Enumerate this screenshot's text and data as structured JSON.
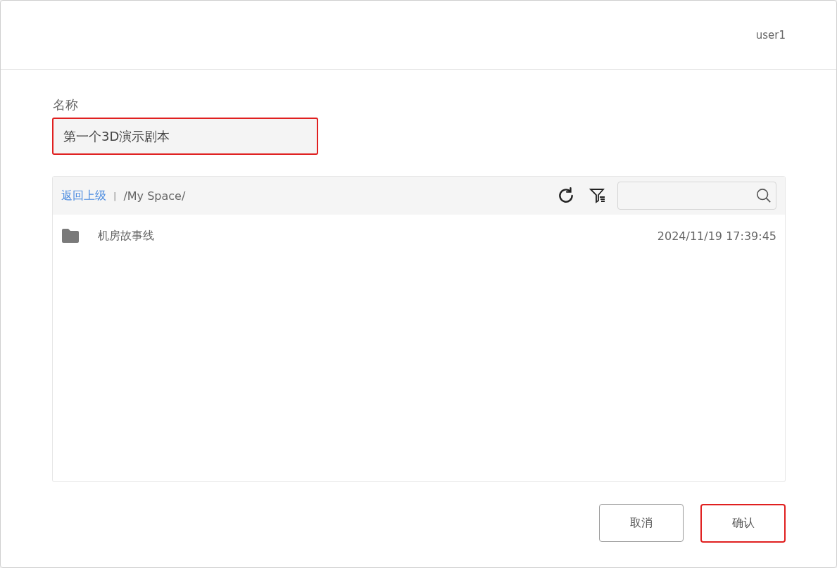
{
  "header": {
    "user": "user1"
  },
  "name_field": {
    "label": "名称",
    "value": "第一个3D演示剧本",
    "highlighted": true
  },
  "browser": {
    "back_link": "返回上级",
    "separator": "|",
    "path": "/My Space/",
    "items": [
      {
        "kind": "folder",
        "name": "机房故事线",
        "modified": "2024/11/19 17:39:45"
      }
    ]
  },
  "buttons": [
    {
      "label": "取消",
      "highlighted": false
    },
    {
      "label": "确认",
      "highlighted": true
    }
  ]
}
